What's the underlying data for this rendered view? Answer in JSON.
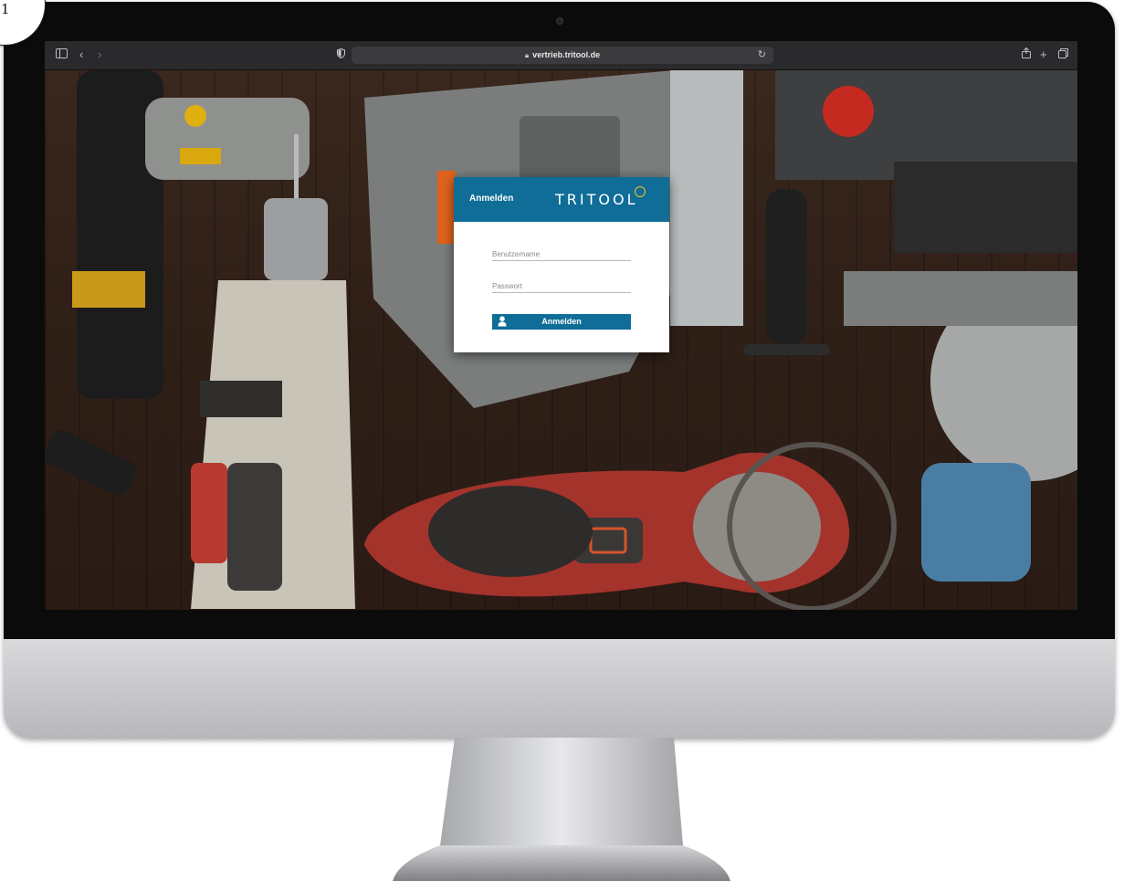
{
  "corner_badge": {
    "label": "1"
  },
  "browser": {
    "url": "vertrieb.tritool.de",
    "icons": {
      "sidebar": "sidebar-icon",
      "back": "chevron-left-icon",
      "forward": "chevron-right-icon",
      "privacy": "shield-icon",
      "lock": "lock-icon",
      "reload": "reload-icon",
      "share": "share-icon",
      "new_tab": "plus-icon",
      "tabs": "tabs-overview-icon"
    }
  },
  "login": {
    "title": "Anmelden",
    "brand": "TRITOOL",
    "username_placeholder": "Benutzername",
    "password_placeholder": "Passwort",
    "submit_label": "Anmelden",
    "submit_icon": "user-icon"
  },
  "colors": {
    "accent": "#0f6d97",
    "brand_mark": "#f2c230"
  }
}
